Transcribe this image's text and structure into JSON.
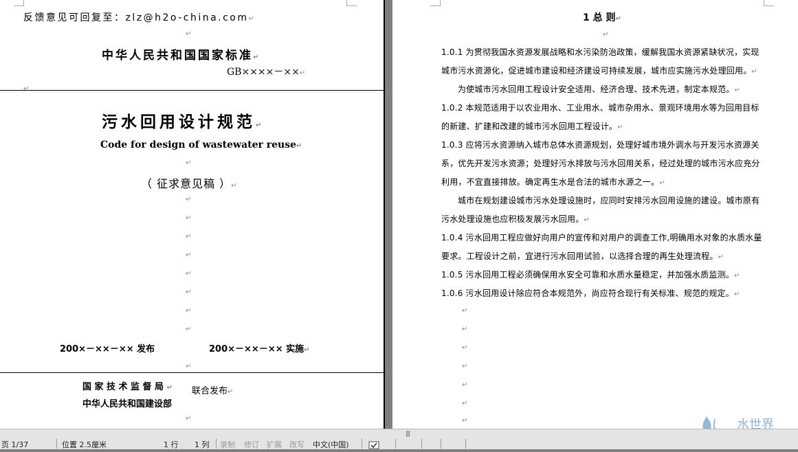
{
  "left_page": {
    "feedback": "反馈意见可回复至：zlz@h2o-china.com",
    "standard_title": "中华人民共和国国家标准",
    "gb_number": "GB××××－××",
    "cn_title": "污水回用设计规范",
    "en_title": "Code for design of wastewater reuse",
    "draft": "（ 征求意见稿 ）",
    "publish": "200×－××－×× 发布",
    "implement": "200×－××－×× 实施",
    "issuer1": "国家技术监督局",
    "issuer2": "中华人民共和国建设部",
    "joint": "联合发布"
  },
  "right_page": {
    "chapter": "1  总 则",
    "paragraphs": [
      "1.0.1  为贯彻我国水资源发展战略和水污染防治政策，缓解我国水资源紧缺状况，实现城市污水资源化，促进城市建设和经济建设可持续发展，城市应实施污水处理回用。",
      "为使城市污水回用工程设计安全适用、经济合理、技术先进，制定本规范。",
      "1.0.2  本规范适用于以农业用水、工业用水、城市杂用水、景观环境用水等为回用目标的新建、扩建和改建的城市污水回用工程设计。",
      "1.0.3  应将污水资源纳入城市总体水资源规划，处理好城市境外调水与开发污水资源关系，优先开发污水资源；处理好污水排放与污水回用关系，经过处理的城市污水应充分利用，不宜直接排放。确定再生水是合法的城市水源之一。",
      "城市在规划建设城市污水处理设施时，应同时安排污水回用设施的建设。城市原有污水处理设施也应积极发展污水回用。",
      "1.0.4  污水回用工程应做好向用户的宣传和对用户的调查工作,明确用水对象的水质水量要求。工程设计之前，宜进行污水回用试验，以选择合理的再生处理流程。",
      "1.0.5  污水回用工程必须确保用水安全可靠和水质水量稳定，并加强水质监测。",
      "1.0.6  污水回用设计除应符合本规范外，尚应符合现行有关标准、规范的规定。"
    ]
  },
  "status_bar": {
    "page": "页  1/37",
    "position": "位置 2.5厘米",
    "line": "1 行",
    "column": "1 列",
    "record": "录制",
    "revise": "修订",
    "extend": "扩展",
    "overwrite": "改写",
    "language": "中文(中国)"
  },
  "logo_text": "水世界"
}
